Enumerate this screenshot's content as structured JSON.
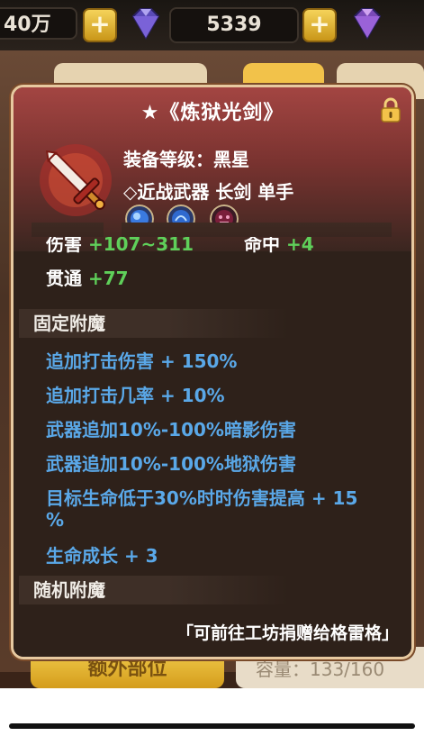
{
  "topbar": {
    "currency1_value": "40万",
    "currency2_value": "5339",
    "plus_symbol": "+"
  },
  "background": {
    "extra_slot_button": "额外部位",
    "capacity_text": "容量：133/160"
  },
  "tooltip": {
    "title": "★《炼狱光剑》",
    "equip_level_label": "装备等级：",
    "equip_level_value": "黑星",
    "type_line": "◇近战武器 长剑 单手",
    "stats": [
      {
        "label": "伤害",
        "value": "+107~311"
      },
      {
        "label": "命中",
        "value": "+4"
      },
      {
        "label": "贯通",
        "value": "+77"
      }
    ],
    "fixed_enchant_header": "固定附魔",
    "fixed_enchants": [
      "追加打击伤害 + 150%",
      "追加打击几率 + 10%",
      "武器追加10%-100%暗影伤害",
      "武器追加10%-100%地狱伤害",
      "目标生命低于30%时时伤害提高 + 15",
      "%",
      "生命成长 + 3"
    ],
    "random_enchant_header": "随机附魔",
    "footer_note": "「可前往工坊捐赠给格雷格」"
  },
  "colors": {
    "stat_green": "#5fd05a",
    "enchant_blue": "#5aa8e8",
    "panel_border": "#e7c9a0"
  },
  "icons": [
    "gem-icon",
    "lock-icon",
    "sword-icon",
    "water-rune-icon",
    "demon-rune-icon"
  ]
}
